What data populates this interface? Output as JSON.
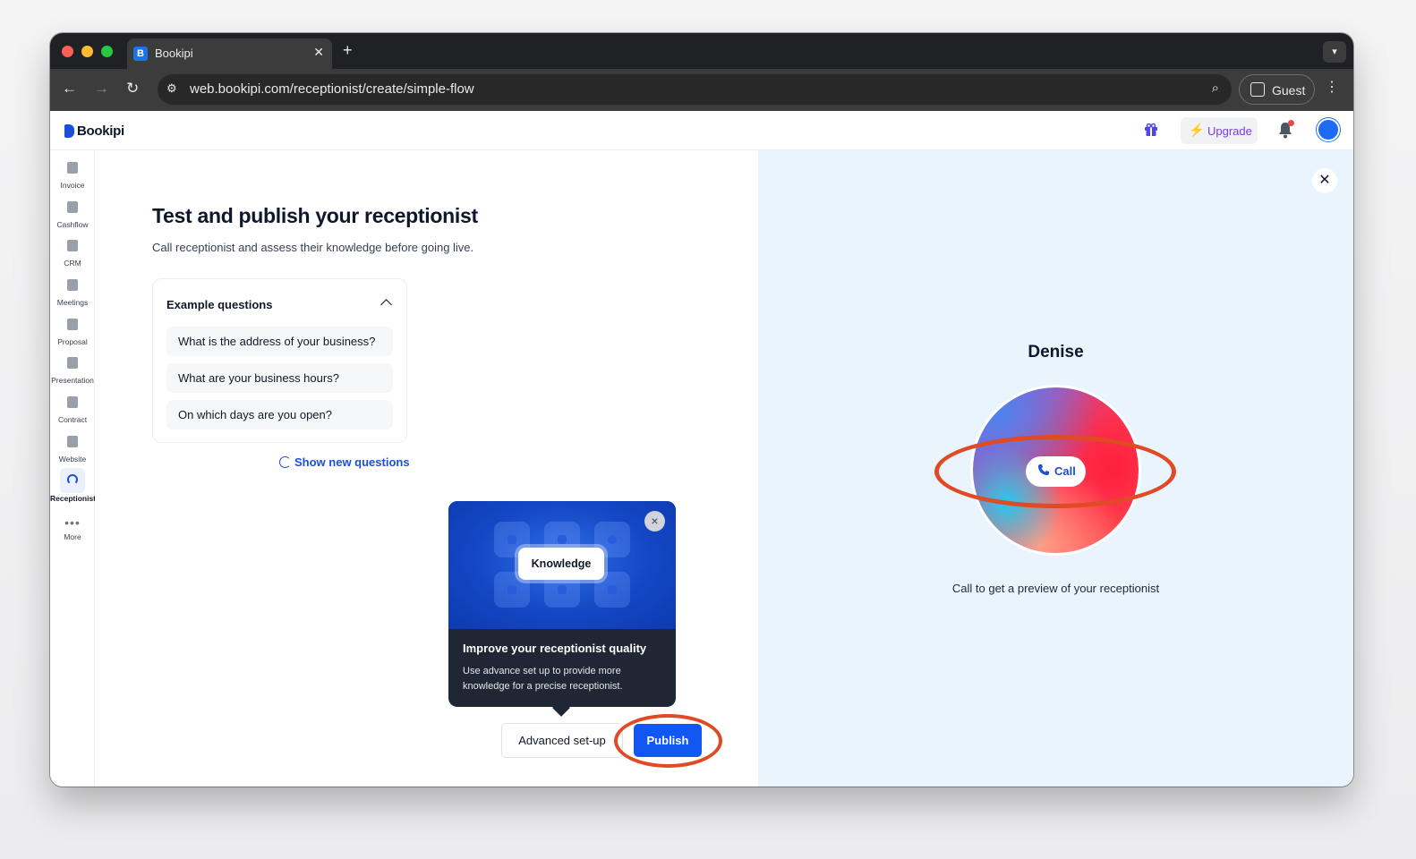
{
  "browser": {
    "tab_title": "Bookipi",
    "tab_favicon": "B",
    "url": "web.bookipi.com/receptionist/create/simple-flow",
    "profile_label": "Guest"
  },
  "header": {
    "logo_text": "Bookipi",
    "upgrade_label": "Upgrade"
  },
  "sidebar": {
    "items": [
      {
        "label": "Invoice"
      },
      {
        "label": "Cashflow"
      },
      {
        "label": "CRM"
      },
      {
        "label": "Meetings"
      },
      {
        "label": "Proposal"
      },
      {
        "label": "Presentation"
      },
      {
        "label": "Contract"
      },
      {
        "label": "Website"
      },
      {
        "label": "Receptionist",
        "active": true
      },
      {
        "label": "More"
      }
    ]
  },
  "main": {
    "title": "Test and publish your receptionist",
    "subtitle": "Call receptionist and assess their knowledge before going live.",
    "questions_header": "Example questions",
    "questions": [
      "What is the address of your business?",
      "What are your business hours?",
      "On which days are you open?"
    ],
    "show_new_label": "Show new questions",
    "popover": {
      "chip_label": "Knowledge",
      "title": "Improve your receptionist quality",
      "body": "Use advance set up to provide more knowledge for a precise receptionist."
    },
    "advanced_label": "Advanced set-up",
    "publish_label": "Publish"
  },
  "preview": {
    "agent_name": "Denise",
    "call_label": "Call",
    "hint": "Call to get a preview of your receptionist"
  },
  "colors": {
    "accent": "#1357f2",
    "annotation": "#e04a24",
    "preview_bg": "#eaf4fd",
    "upgrade": "#7c3aed"
  }
}
